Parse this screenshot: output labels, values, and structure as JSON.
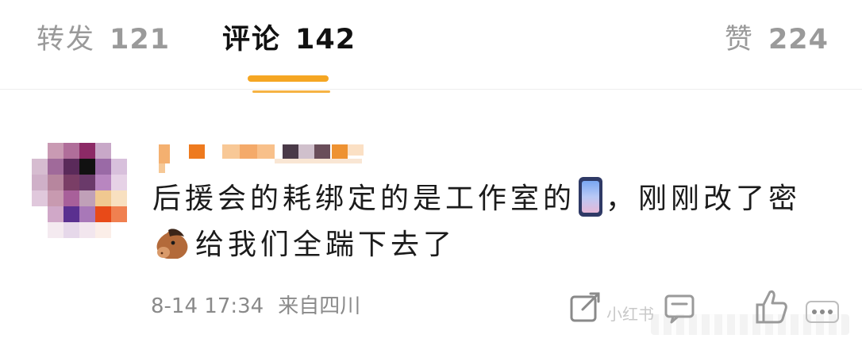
{
  "tabs": {
    "repost": {
      "label": "转发",
      "count": "121"
    },
    "comment": {
      "label": "评论",
      "count": "142"
    },
    "like": {
      "label": "赞",
      "count": "224"
    }
  },
  "comment": {
    "line1_a": "后援会的耗绑定的是工作室的",
    "line1_b": "，刚刚改了密",
    "line2": "给我们全踹下去了",
    "emoji_1": "mobile-phone-emoji",
    "emoji_2": "horse-face-emoji",
    "date_time": "8-14 17:34",
    "location": "来自四川"
  },
  "watermark": {
    "text": "小红书"
  },
  "colors": {
    "accent": "#f5a623",
    "muted_text": "#9a9a9a",
    "primary_text": "#111111"
  },
  "icons": [
    "share-icon",
    "comment-icon",
    "like-icon",
    "more-icon"
  ]
}
